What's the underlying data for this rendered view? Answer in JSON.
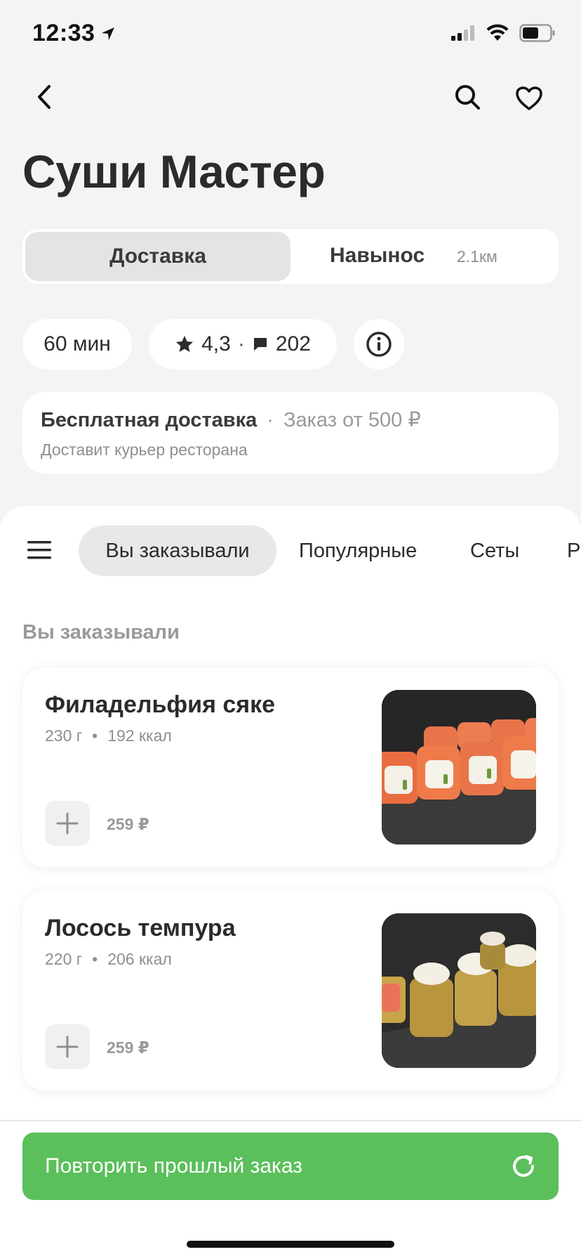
{
  "status": {
    "time": "12:33"
  },
  "header": {
    "title": "Суши Мастер"
  },
  "segment": {
    "delivery_label": "Доставка",
    "pickup_label": "Навынос",
    "distance": "2.1км"
  },
  "chips": {
    "time": "60 мин",
    "rating": "4,3",
    "separator": "·",
    "reviews": "202"
  },
  "delivery": {
    "free_label": "Бесплатная доставка",
    "separator": "·",
    "min_order": "Заказ от 500 ₽",
    "courier": "Доставит курьер ресторана"
  },
  "categories": [
    {
      "label": "Вы заказывали",
      "active": true
    },
    {
      "label": "Популярные",
      "active": false
    },
    {
      "label": "Сеты",
      "active": false
    },
    {
      "label": "Р",
      "active": false
    }
  ],
  "section": {
    "title": "Вы заказывали"
  },
  "products": [
    {
      "name": "Филадельфия сяке",
      "weight": "230 г",
      "dot": "•",
      "kcal": "192 ккал",
      "price": "259 ₽"
    },
    {
      "name": "Лосось темпура",
      "weight": "220 г",
      "dot": "•",
      "kcal": "206 ккал",
      "price": "259 ₽"
    }
  ],
  "repeat": {
    "label": "Повторить прошлый заказ"
  },
  "colors": {
    "accent_green": "#5bbf5b",
    "background": "#f4f4f4",
    "card": "#ffffff",
    "muted_text": "#8e8e93"
  }
}
